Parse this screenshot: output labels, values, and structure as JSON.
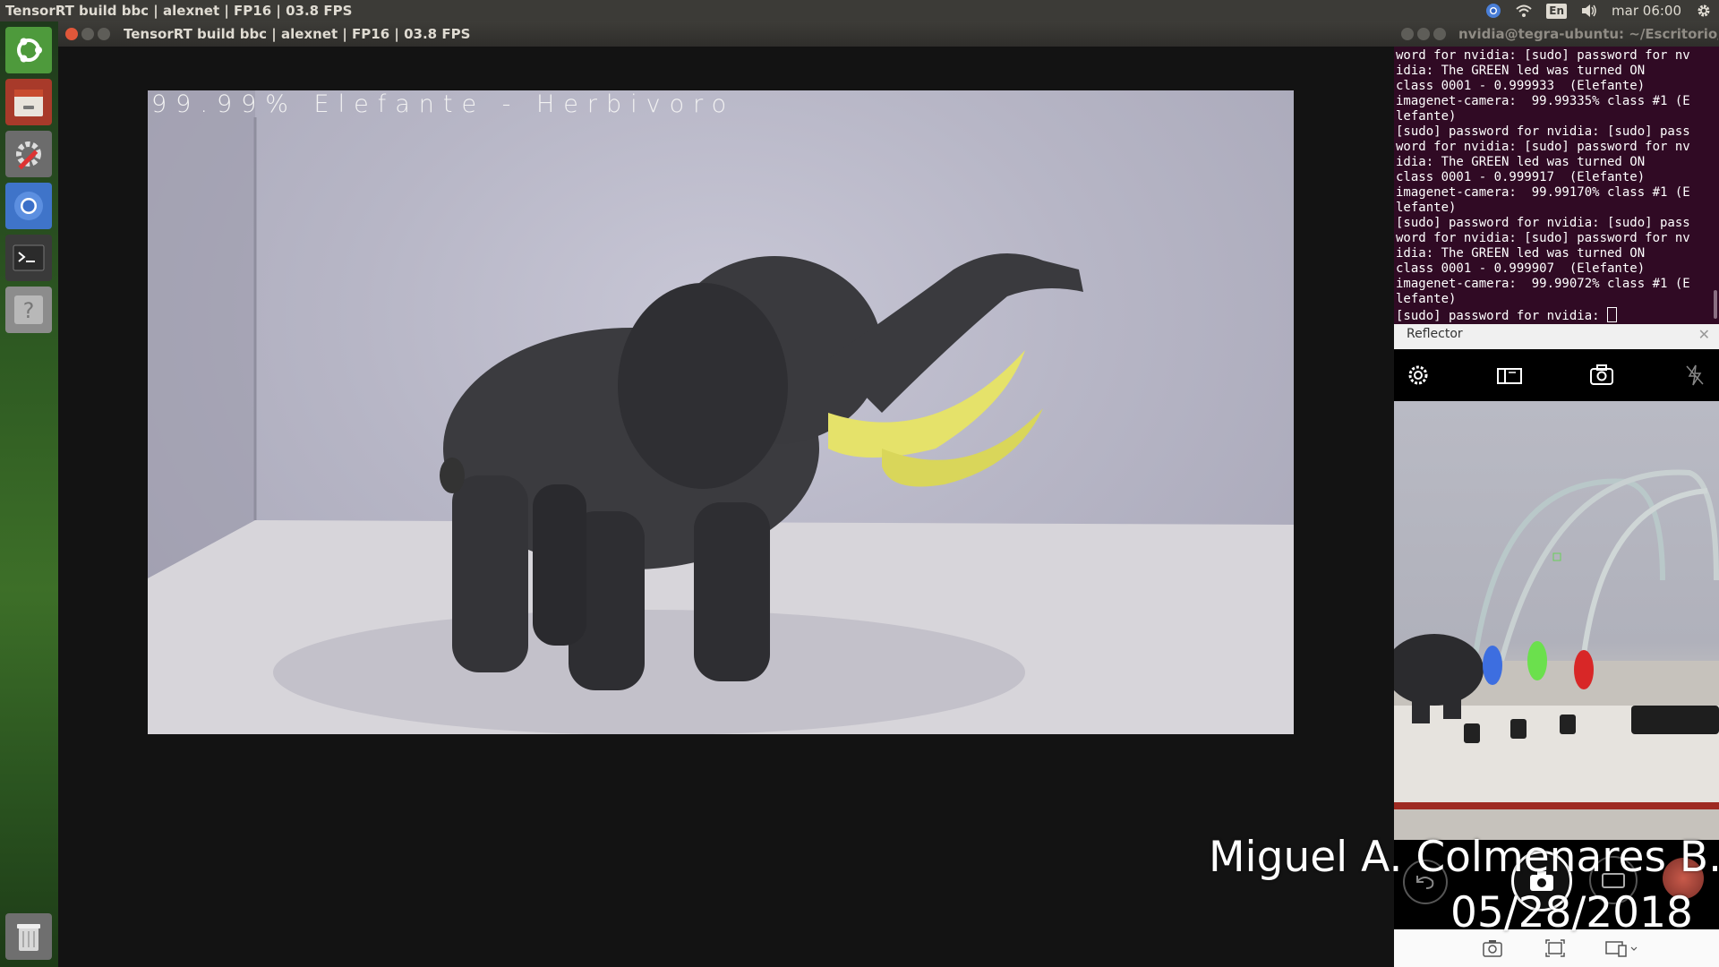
{
  "top_panel": {
    "window_title": "TensorRT build bbc | alexnet | FP16 | 03.8 FPS",
    "keyboard_layout": "En",
    "clock": "mar 06:00"
  },
  "launcher": {
    "items": [
      {
        "name": "ubuntu-dash",
        "icon": "ubuntu-logo-icon"
      },
      {
        "name": "files",
        "icon": "file-cabinet-icon"
      },
      {
        "name": "system-settings",
        "icon": "settings-tools-icon"
      },
      {
        "name": "chromium",
        "icon": "chromium-icon"
      },
      {
        "name": "terminal",
        "icon": "terminal-icon"
      },
      {
        "name": "help",
        "icon": "help-icon"
      },
      {
        "name": "trash",
        "icon": "trash-icon"
      }
    ]
  },
  "main_window": {
    "title": "TensorRT build bbc | alexnet | FP16 | 03.8 FPS",
    "overlay": "99.99% Elefante - Herbivoro"
  },
  "terminal": {
    "title": "nvidia@tegra-ubuntu: ~/Escritorio/jetson",
    "lines": [
      "word for nvidia: [sudo] password for nv",
      "idia: The GREEN led was turned ON",
      "class 0001 - 0.999933  (Elefante)",
      "imagenet-camera:  99.99335% class #1 (E",
      "lefante)",
      "[sudo] password for nvidia: [sudo] pass",
      "word for nvidia: [sudo] password for nv",
      "idia: The GREEN led was turned ON",
      "class 0001 - 0.999917  (Elefante)",
      "imagenet-camera:  99.99170% class #1 (E",
      "lefante)",
      "[sudo] password for nvidia: [sudo] pass",
      "word for nvidia: [sudo] password for nv",
      "idia: The GREEN led was turned ON",
      "class 0001 - 0.999907  (Elefante)",
      "imagenet-camera:  99.99072% class #1 (E",
      "lefante)"
    ],
    "prompt_line": "[sudo] password for nvidia: "
  },
  "reflector": {
    "title": "Reflector",
    "toolbar": [
      "settings-icon",
      "camera-flip-icon",
      "camera-switch-icon",
      "flash-off-icon"
    ]
  },
  "watermark": {
    "name": "Miguel A. Colmenares B.",
    "date": "05/28/2018"
  }
}
